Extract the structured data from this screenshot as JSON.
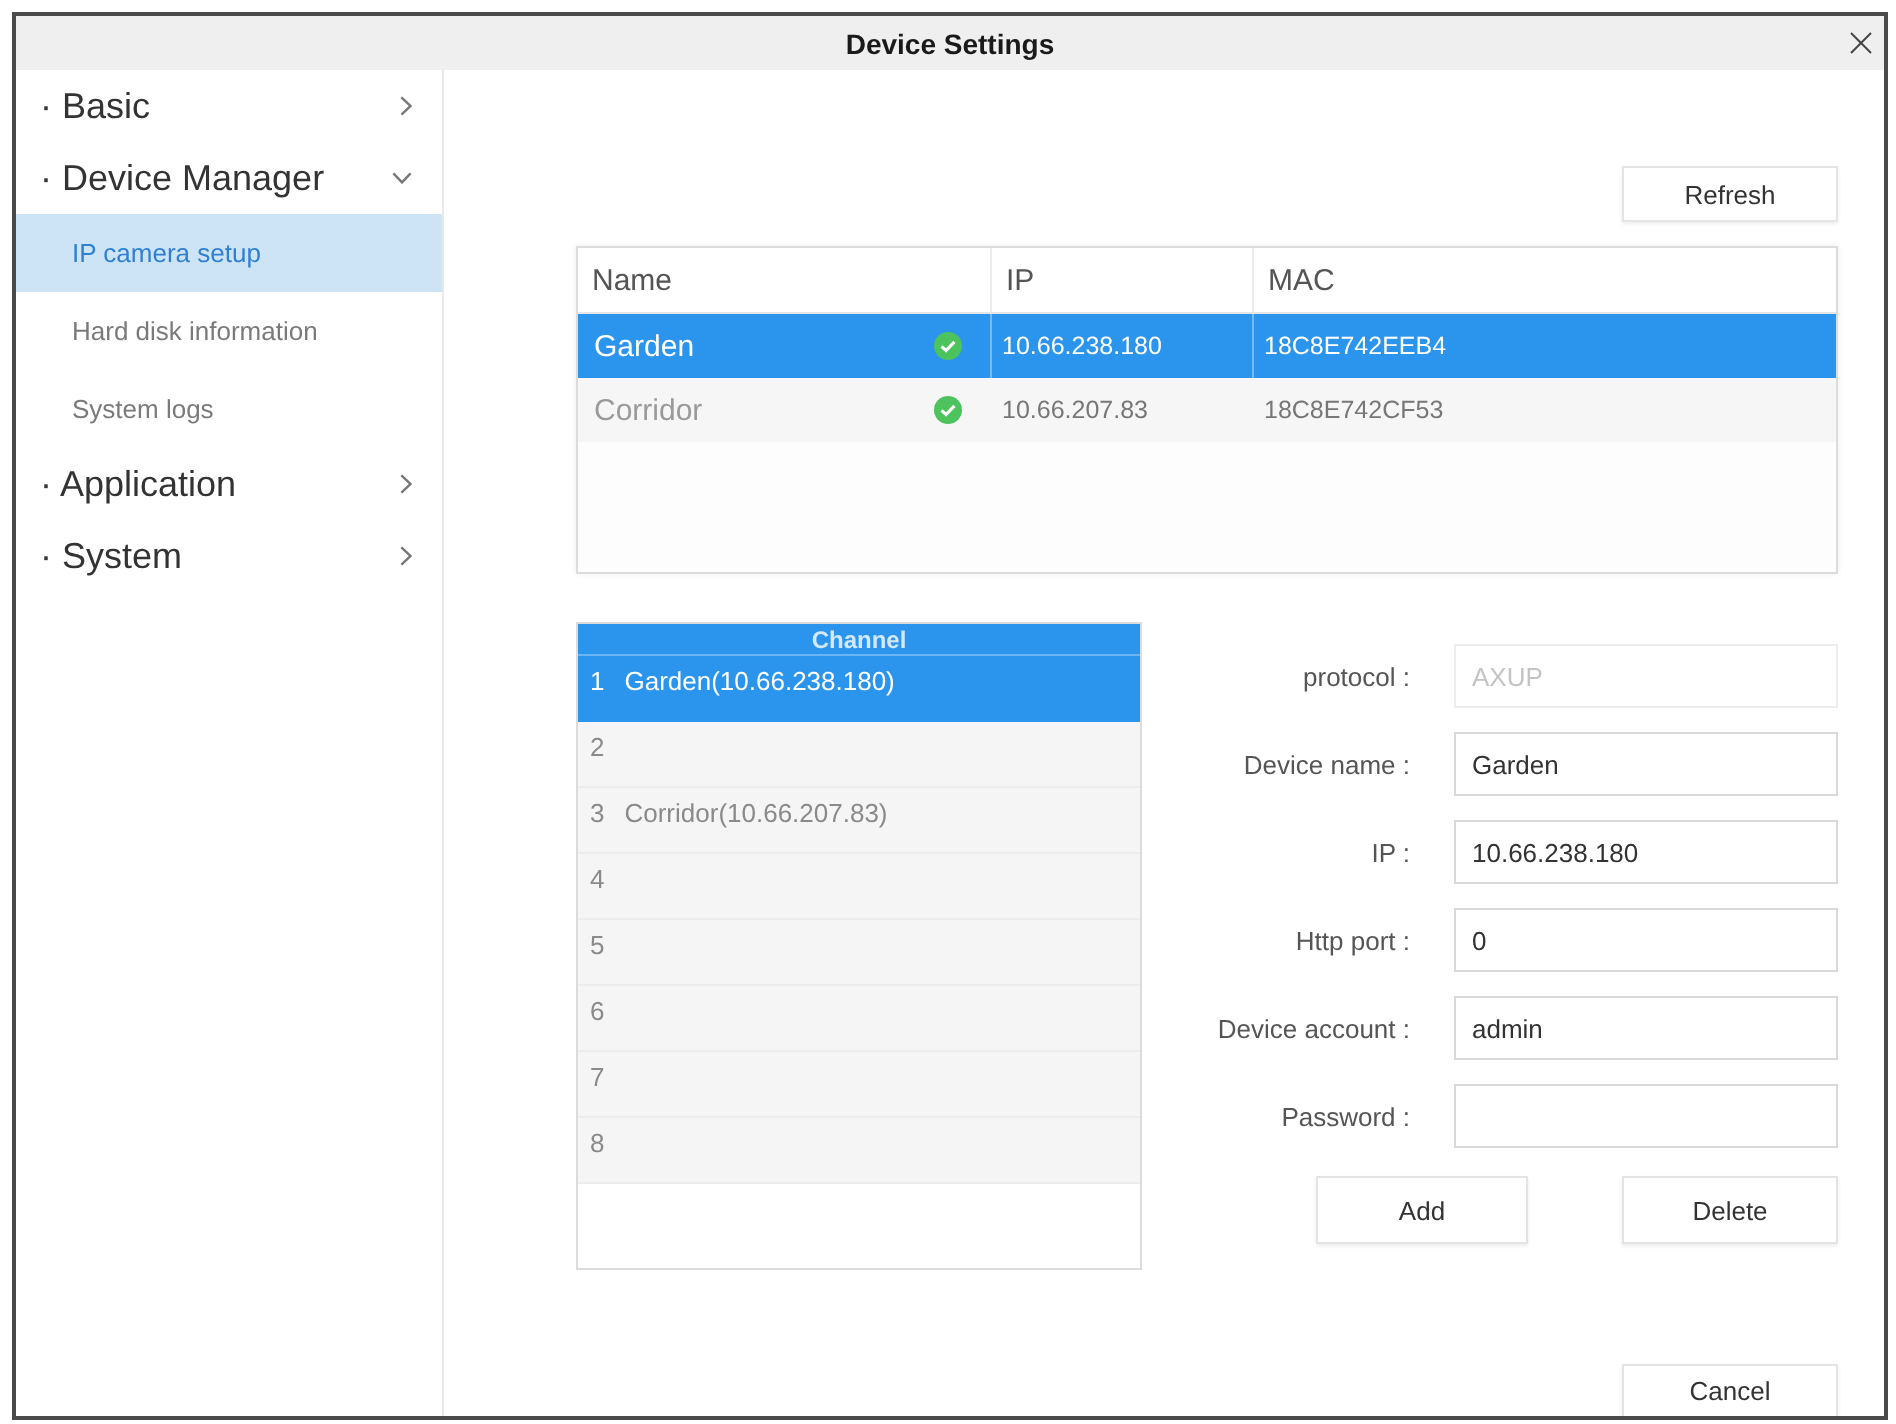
{
  "window": {
    "title": "Device Settings"
  },
  "sidebar": {
    "sections": [
      {
        "label": "· Basic",
        "expanded": false
      },
      {
        "label": "· Device Manager",
        "expanded": true,
        "children": [
          {
            "label": "IP camera setup",
            "selected": true
          },
          {
            "label": "Hard disk information",
            "selected": false
          },
          {
            "label": "System logs",
            "selected": false
          }
        ]
      },
      {
        "label": "· Application",
        "expanded": false
      },
      {
        "label": "· System",
        "expanded": false
      }
    ]
  },
  "refresh_button": "Refresh",
  "device_table": {
    "columns": [
      "Name",
      "IP",
      "MAC"
    ],
    "rows": [
      {
        "name": "Garden",
        "online": true,
        "ip": "10.66.238.180",
        "mac": "18C8E742EEB4",
        "selected": true
      },
      {
        "name": "Corridor",
        "online": true,
        "ip": "10.66.207.83",
        "mac": "18C8E742CF53",
        "selected": false
      }
    ]
  },
  "channel_list": {
    "title": "Channel",
    "channels": [
      {
        "number": "1",
        "device": "Garden(10.66.238.180)",
        "selected": true
      },
      {
        "number": "2",
        "selected": false
      },
      {
        "number": "3",
        "device": "Corridor(10.66.207.83)",
        "selected": false
      },
      {
        "number": "4",
        "selected": false
      },
      {
        "number": "5",
        "selected": false
      },
      {
        "number": "6",
        "selected": false
      },
      {
        "number": "7",
        "selected": false
      },
      {
        "number": "8",
        "selected": false
      }
    ]
  },
  "form": {
    "fields": [
      {
        "label": "protocol :",
        "value": "AXUP",
        "disabled": true
      },
      {
        "label": "Device name :",
        "value": "Garden",
        "disabled": false
      },
      {
        "label": "IP :",
        "value": "10.66.238.180",
        "disabled": false
      },
      {
        "label": "Http port :",
        "value": "0",
        "disabled": false
      },
      {
        "label": "Device account :",
        "value": "admin",
        "disabled": false
      },
      {
        "label": "Password :",
        "disabled": false
      }
    ],
    "add_button": "Add",
    "delete_button": "Delete"
  },
  "cancel_button": "Cancel"
}
